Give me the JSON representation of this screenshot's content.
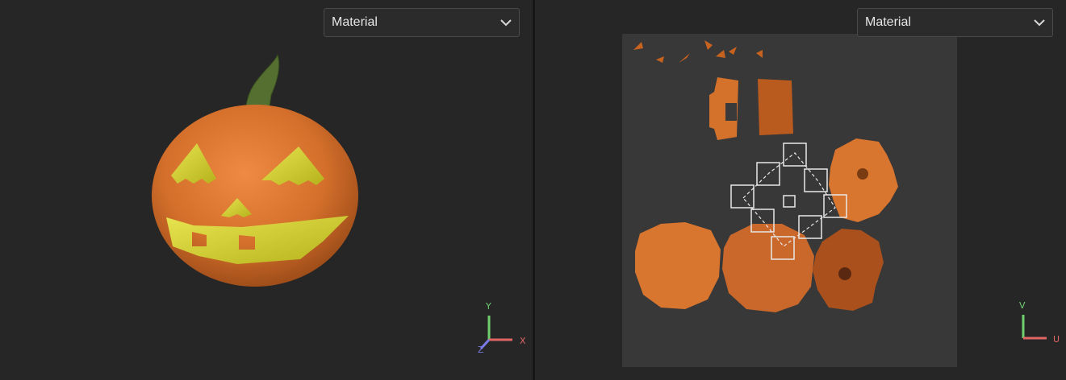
{
  "left_viewport": {
    "material_dropdown": {
      "value": "Material"
    },
    "gizmo": {
      "x_label": "X",
      "y_label": "Y",
      "z_label": "Z"
    },
    "colors": {
      "x_axis": "#e06666",
      "y_axis": "#6fcf6f",
      "z_axis": "#7a7ae6"
    }
  },
  "right_viewport": {
    "material_dropdown": {
      "value": "Material"
    },
    "gizmo": {
      "u_label": "U",
      "v_label": "V"
    },
    "colors": {
      "uv_canvas": "#383838",
      "uv_selection": "#e8e8e8"
    }
  },
  "icons": [
    "chevron-down-icon",
    "axis-gizmo-icon",
    "uv-axis-icon"
  ],
  "colors": {
    "pumpkin_orange": "#d8752f",
    "carved_yellow": "#d6d62b",
    "stem_green": "#4f6a2e",
    "background": "#262626"
  }
}
